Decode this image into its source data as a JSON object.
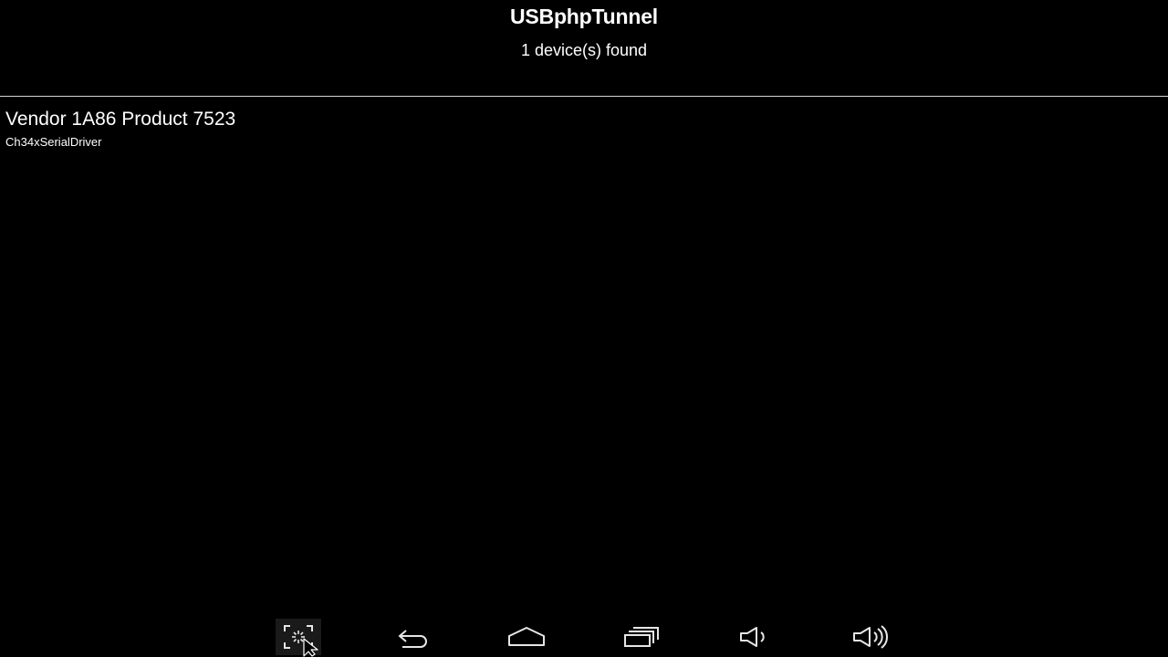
{
  "app": {
    "title": "USBphpTunnel",
    "status": "1 device(s) found"
  },
  "devices": [
    {
      "name": "Vendor 1A86 Product 7523",
      "driver": "Ch34xSerialDriver"
    }
  ],
  "nav_bar": {
    "buttons": [
      {
        "icon": "screenshot-icon",
        "active": true
      },
      {
        "icon": "back-icon"
      },
      {
        "icon": "home-icon"
      },
      {
        "icon": "recent-apps-icon"
      },
      {
        "icon": "volume-down-icon"
      },
      {
        "icon": "volume-up-icon"
      }
    ]
  },
  "colors": {
    "background": "#000000",
    "text": "#ffffff",
    "divider": "#d8d8d8",
    "nav_icon": "#e6e6e6"
  }
}
